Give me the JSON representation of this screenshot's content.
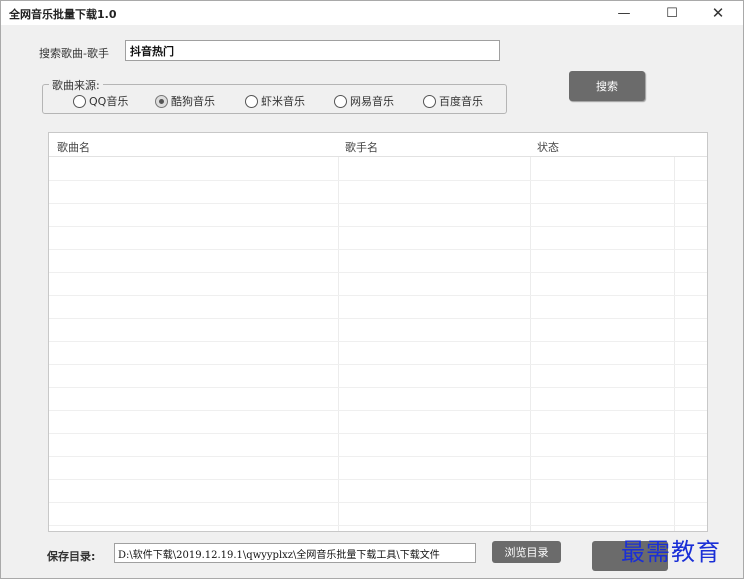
{
  "window": {
    "title": "全网音乐批量下载1.0",
    "controls": {
      "minimize": "—",
      "maximize": "☐",
      "close": "✕"
    }
  },
  "search": {
    "label": "搜索歌曲-歌手",
    "value": "抖音热门",
    "button_label": "搜索"
  },
  "source": {
    "legend": "歌曲来源:",
    "options": [
      {
        "label": "QQ音乐",
        "checked": false
      },
      {
        "label": "酷狗音乐",
        "checked": true
      },
      {
        "label": "虾米音乐",
        "checked": false
      },
      {
        "label": "网易音乐",
        "checked": false
      },
      {
        "label": "百度音乐",
        "checked": false
      }
    ]
  },
  "table": {
    "columns": [
      "歌曲名",
      "歌手名",
      "状态"
    ],
    "rows": []
  },
  "save": {
    "label": "保存目录:",
    "path": "D:\\软件下载\\2019.12.19.1\\qwyyplxz\\全网音乐批量下载工具\\下载文件",
    "browse_label": "浏览目录"
  },
  "watermark": "最需教育"
}
